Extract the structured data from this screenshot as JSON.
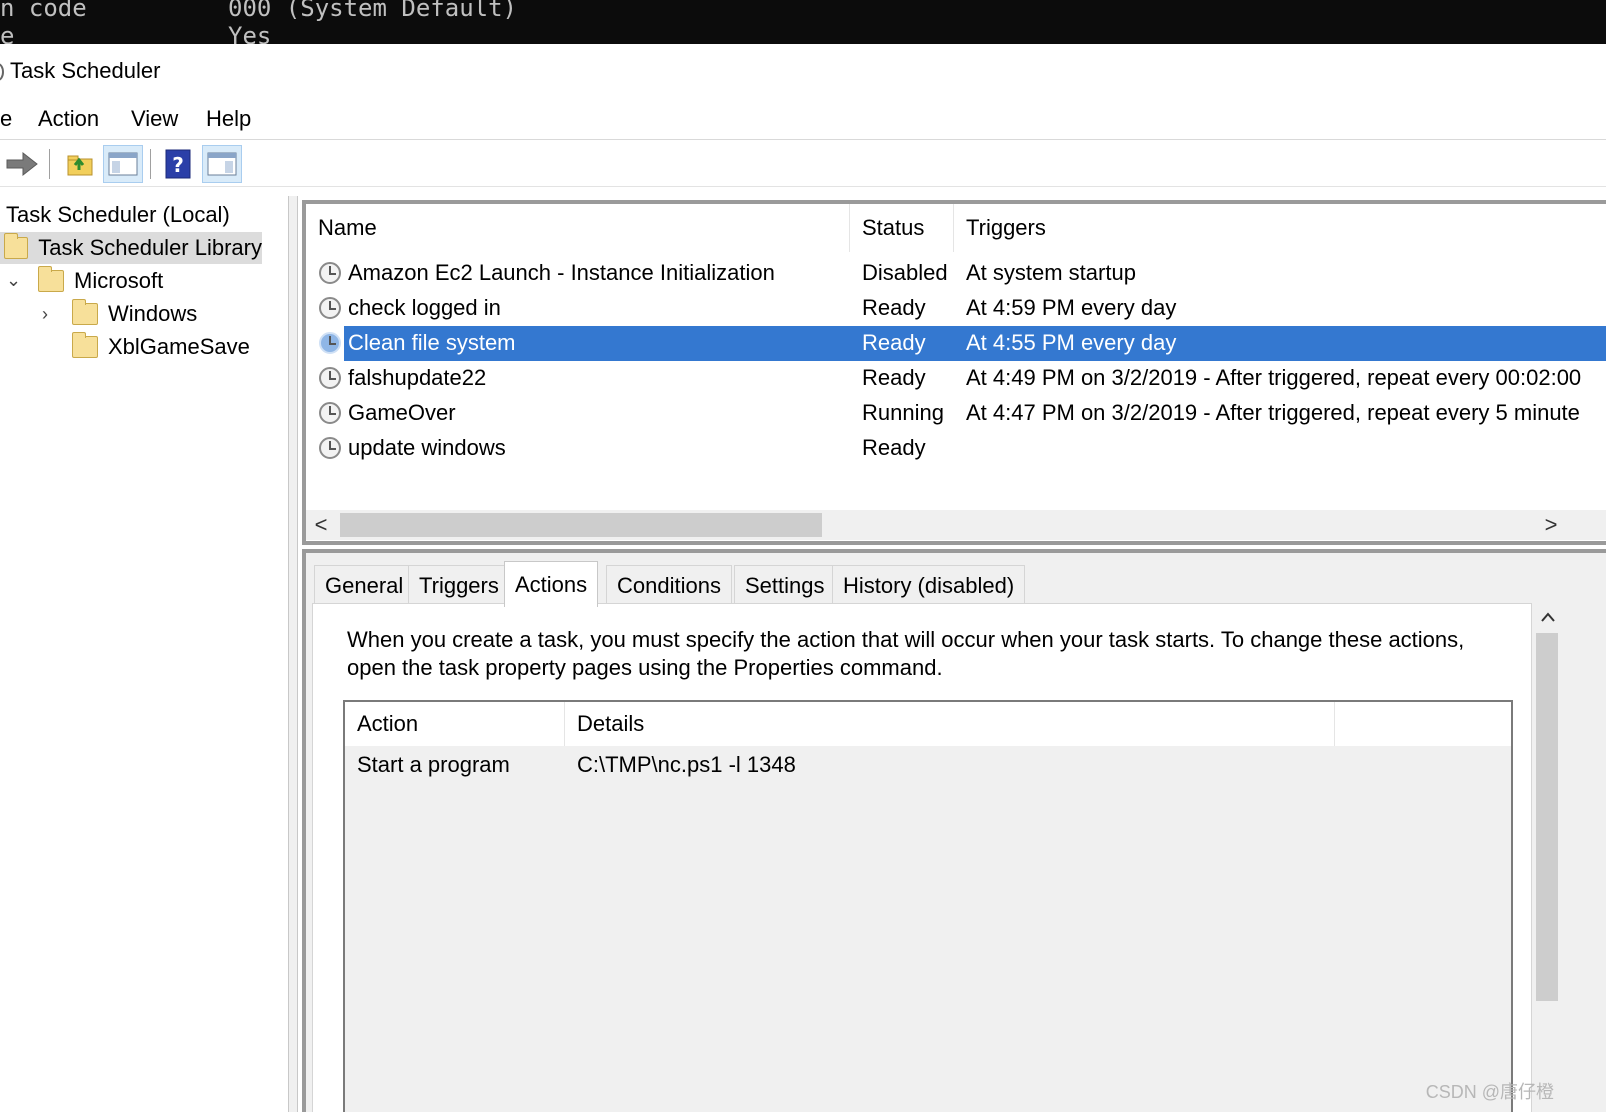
{
  "console": {
    "line1_left": "n code",
    "line1_right": "000 (System Default)",
    "line2_left": "e",
    "line2_right": "Yes"
  },
  "window": {
    "title": "Task Scheduler"
  },
  "menu": {
    "partial": "e",
    "action": "Action",
    "view": "View",
    "help": "Help"
  },
  "toolbar": {
    "buttons": [
      "forward-arrow-icon",
      "open-folder-icon",
      "console-tree-icon",
      "help-icon",
      "action-pane-icon"
    ]
  },
  "tree": {
    "root": "Task Scheduler (Local)",
    "library": "Task Scheduler Library",
    "microsoft": "Microsoft",
    "windows": "Windows",
    "xbl": "XblGameSave"
  },
  "tasks": {
    "columns": {
      "name": "Name",
      "status": "Status",
      "triggers": "Triggers"
    },
    "rows": [
      {
        "name": "Amazon Ec2 Launch - Instance Initialization",
        "status": "Disabled",
        "trigger": "At system startup"
      },
      {
        "name": "check logged in",
        "status": "Ready",
        "trigger": "At 4:59 PM every day"
      },
      {
        "name": "Clean file system",
        "status": "Ready",
        "trigger": "At 4:55 PM every day"
      },
      {
        "name": "falshupdate22",
        "status": "Ready",
        "trigger": "At 4:49 PM on 3/2/2019 - After triggered, repeat every 00:02:00"
      },
      {
        "name": "GameOver",
        "status": "Running",
        "trigger": "At 4:47 PM on 3/2/2019 - After triggered, repeat every 5 minute"
      },
      {
        "name": "update windows",
        "status": "Ready",
        "trigger": ""
      }
    ],
    "selected_row": "Clean file system",
    "scroll_left_glyph": "<",
    "scroll_right_glyph": ">"
  },
  "tabs": [
    "General",
    "Triggers",
    "Actions",
    "Conditions",
    "Settings",
    "History (disabled)"
  ],
  "active_tab": "Actions",
  "actions_tab": {
    "description": "When you create a task, you must specify the action that will occur when your task starts.  To change these actions, open the task property pages using the Properties command.",
    "columns": {
      "action": "Action",
      "details": "Details"
    },
    "rows": [
      {
        "action": "Start a program",
        "details": "C:\\TMP\\nc.ps1 -l 1348"
      }
    ]
  },
  "vscroll_up_glyph": "^",
  "watermark": "CSDN @唐仔橙",
  "colors": {
    "selection": "#3478d0",
    "console_bg": "#0c0c0c"
  }
}
